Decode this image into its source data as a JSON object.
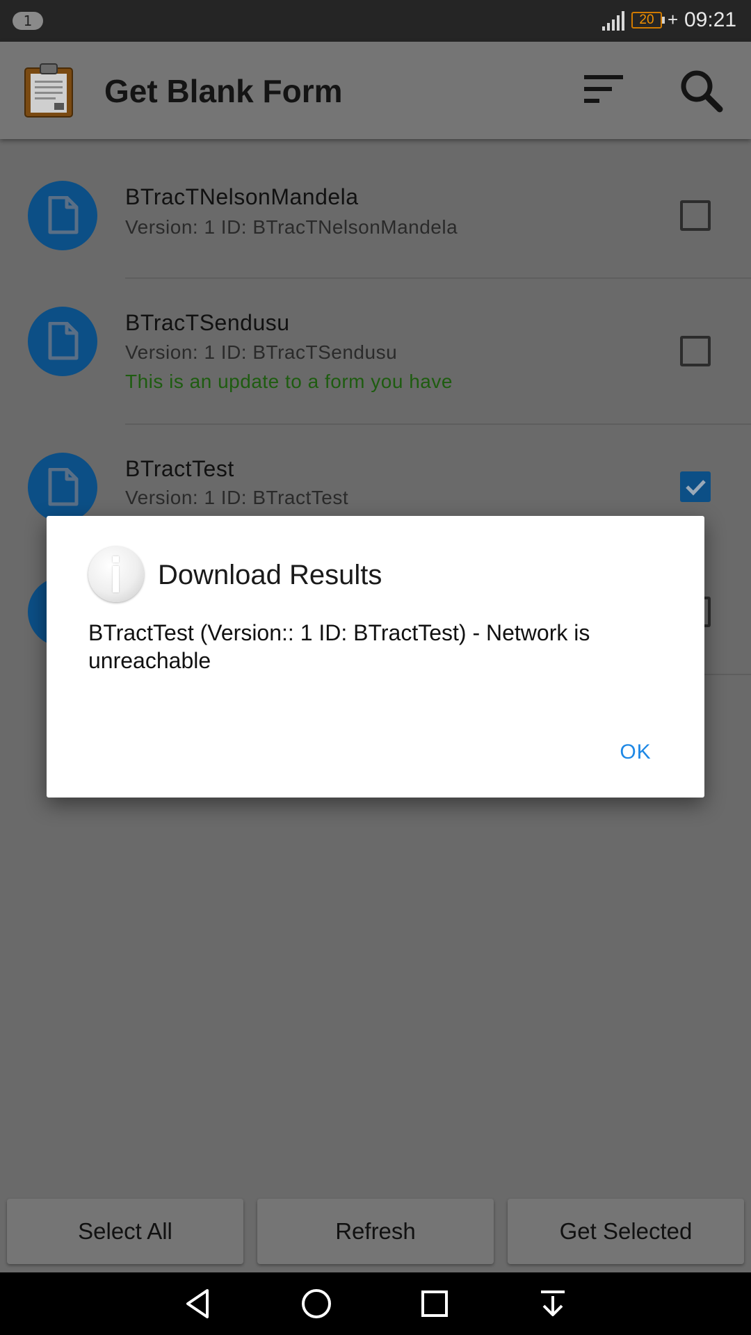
{
  "status_bar": {
    "notification_count": "1",
    "battery_level": "20",
    "charging": "+",
    "time": "09:21"
  },
  "app_bar": {
    "title": "Get Blank Form",
    "app_icon": "clipboard-icon",
    "actions": [
      "sort-icon",
      "search-icon"
    ]
  },
  "forms": [
    {
      "name": "BTracTNelsonMandela",
      "subtitle": "Version: 1 ID: BTracTNelsonMandela",
      "update_note": "",
      "checked": false
    },
    {
      "name": "BTracTSendusu",
      "subtitle": "Version: 1 ID: BTracTSendusu",
      "update_note": "This is an update to a form you have",
      "checked": false
    },
    {
      "name": "BTractTest",
      "subtitle": "Version: 1 ID: BTractTest",
      "update_note": "",
      "checked": true
    }
  ],
  "dialog": {
    "title": "Download Results",
    "message": "BTractTest (Version:: 1 ID: BTractTest) - Network is unreachable",
    "ok_label": "OK",
    "icon": "info-icon"
  },
  "bottom_buttons": {
    "select_all": "Select All",
    "refresh": "Refresh",
    "get_selected": "Get Selected"
  },
  "colors": {
    "accent_blue": "#0c4f86",
    "dialog_button": "#1e88e5",
    "update_green": "#1e5c10",
    "battery_orange": "#f29100"
  }
}
